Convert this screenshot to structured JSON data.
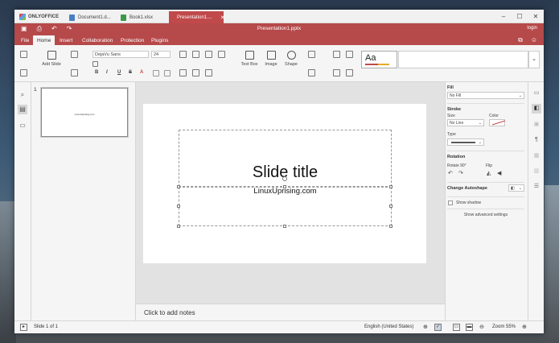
{
  "tabs": {
    "logo": "ONLYOFFICE",
    "items": [
      {
        "label": "Document1.d...",
        "color": "#4a7ec4"
      },
      {
        "label": "Book1.xlsx",
        "color": "#3b9a48"
      },
      {
        "label": "Presentation1....",
        "color": "#c0494b",
        "active": true
      }
    ]
  },
  "window_controls": {
    "minimize": "–",
    "maximize": "☐",
    "close": "✕"
  },
  "titlebar": {
    "title": "Presentation1.pptx",
    "login": "login",
    "quick_access": [
      "save-icon",
      "print-icon",
      "undo-icon",
      "redo-icon"
    ]
  },
  "menu": {
    "tabs": [
      "File",
      "Home",
      "Insert",
      "Collaboration",
      "Protection",
      "Plugins"
    ],
    "active": "Home"
  },
  "toolbar": {
    "add_slide": "Add Slide",
    "font_name": "DejaVu Sans",
    "font_size": "24",
    "bold": "B",
    "italic": "I",
    "underline": "U",
    "strike": "S",
    "text_box": "Text Box",
    "image": "Image",
    "shape": "Shape",
    "theme_preview": "Aa",
    "colors": {
      "accent": "#c0494b",
      "theme_line": "#e8a92a"
    }
  },
  "thumbnails": {
    "slide_number": "1",
    "thumb_text": "LinuxUprising.com"
  },
  "slide": {
    "title": "Slide title",
    "subtitle": "LinuxUprising.com"
  },
  "notes_placeholder": "Click to add notes",
  "right_panel": {
    "fill_header": "Fill",
    "fill_value": "No Fill",
    "stroke_header": "Stroke",
    "size_label": "Size",
    "color_label": "Color",
    "size_value": "No Line",
    "type_label": "Type",
    "rotation_header": "Rotation",
    "rotate_label": "Rotate 90°",
    "flip_label": "Flip",
    "autoshape_header": "Change Autoshape",
    "shadow_label": "Show shadow",
    "advanced_link": "Show advanced settings"
  },
  "statusbar": {
    "slide_info": "Slide 1 of 1",
    "language": "English (United States)",
    "zoom": "Zoom 55%"
  }
}
